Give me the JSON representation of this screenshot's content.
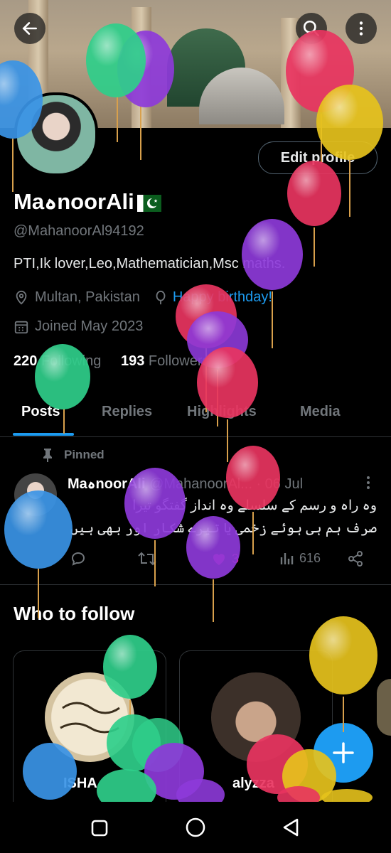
{
  "profile": {
    "display_name": "MaہnoorAli",
    "handle": "@MahanoorAl94192",
    "bio": "PTI,Ik lover,Leo,Mathematician,Msc maths.",
    "location": "Multan, Pakistan",
    "birthday": "Happy birthday!",
    "joined": "Joined May 2023",
    "following_count": "220",
    "following_label": "Following",
    "followers_count": "193",
    "followers_label": "Followers",
    "edit_label": "Edit profile"
  },
  "tabs": [
    "Posts",
    "Replies",
    "Highlights",
    "Media"
  ],
  "pinned_post": {
    "pinned_label": "Pinned",
    "author": "MaہnoorAli",
    "handle": "@MahanoorAl...",
    "date": "· 06 Jul",
    "line1": "وہ راہ و رسم کے سلسلے وہ انداز گفتگو تیرا",
    "line2": "صرف ہم ہی ہوئے زخمی یا تیرے شکار اور بھی ہیں",
    "likes": "3",
    "views": "616"
  },
  "who_to_follow": {
    "title": "Who to follow",
    "cards": [
      {
        "name": "ISHA"
      },
      {
        "name": "alyzza"
      }
    ]
  },
  "colors": {
    "accent": "#1d9bf0",
    "like": "#f91880"
  }
}
